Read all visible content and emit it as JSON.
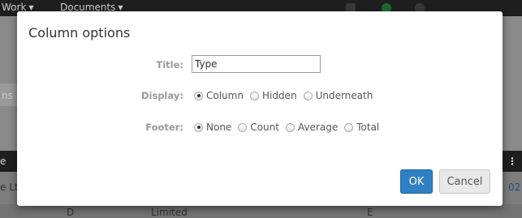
{
  "background": {
    "nav": [
      {
        "label": "Work"
      },
      {
        "label": "Documents"
      }
    ],
    "search_fragment": "ns",
    "table_header_fragment": "e",
    "row_fragment": "e Lt",
    "row_right_fragment": "02",
    "row2_fragment_a": "D",
    "row2_fragment_b": "Limited",
    "row2_fragment_c": "E"
  },
  "modal": {
    "title": "Column options",
    "title_field": {
      "label": "Title:",
      "value": "Type"
    },
    "display": {
      "label": "Display:",
      "selected": "Column",
      "options": [
        "Column",
        "Hidden",
        "Underneath"
      ]
    },
    "footer": {
      "label": "Footer:",
      "selected": "None",
      "options": [
        "None",
        "Count",
        "Average",
        "Total"
      ]
    },
    "ok_label": "OK",
    "cancel_label": "Cancel"
  },
  "colors": {
    "primary": "#2e7fc3",
    "overlay": "#7a7a7a",
    "header_dark": "#1e1e1e"
  }
}
